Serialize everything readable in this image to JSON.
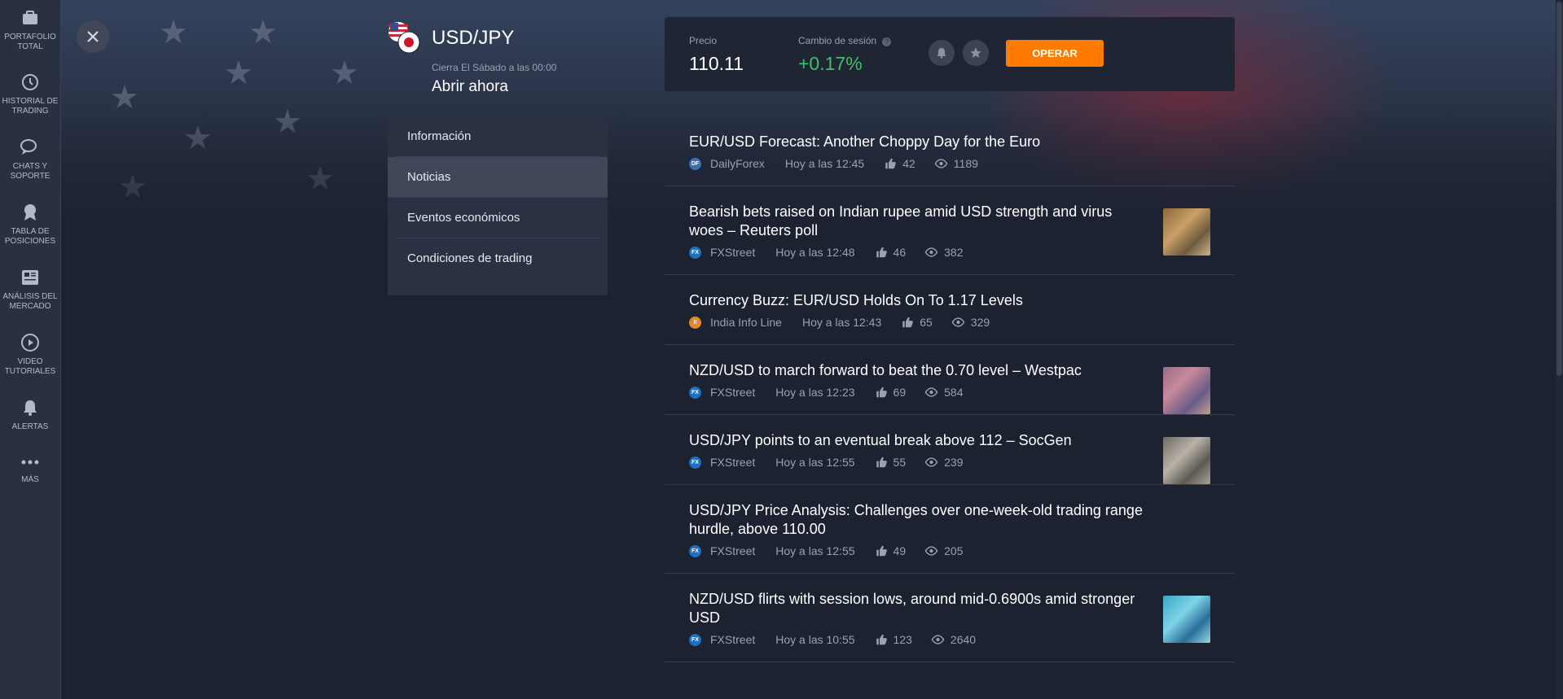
{
  "sidebar": {
    "items": [
      {
        "label_1": "PORTAFOLIO",
        "label_2": "TOTAL",
        "icon": "briefcase-icon"
      },
      {
        "label_1": "HISTORIAL DE",
        "label_2": "TRADING",
        "icon": "history-icon"
      },
      {
        "label_1": "CHATS Y",
        "label_2": "SOPORTE",
        "icon": "chat-icon"
      },
      {
        "label_1": "TABLA DE",
        "label_2": "POSICIONES",
        "icon": "award-icon"
      },
      {
        "label_1": "ANÁLISIS DEL",
        "label_2": "MERCADO",
        "icon": "newspaper-icon"
      },
      {
        "label_1": "VIDEO",
        "label_2": "TUTORIALES",
        "icon": "play-icon"
      },
      {
        "label_1": "ALERTAS",
        "label_2": "",
        "icon": "bell-icon"
      },
      {
        "label_1": "MÁS",
        "label_2": "",
        "icon": "more-dots-icon"
      }
    ]
  },
  "asset": {
    "title": "USD/JPY",
    "closes": "Cierra El Sábado a las 00:00",
    "open_now": "Abrir ahora"
  },
  "menu": {
    "items": [
      "Información",
      "Noticias",
      "Eventos económicos",
      "Condiciones de trading"
    ],
    "active": "Noticias"
  },
  "price_panel": {
    "price_label": "Precio",
    "price": "110.11",
    "change_label": "Cambio de sesión",
    "change": "+0.17%",
    "operate_button": "OPERAR",
    "change_color": "#3fc06a",
    "accent_color": "#ff7b00"
  },
  "news": [
    {
      "title": "EUR/USD Forecast: Another Choppy Day for the Euro",
      "source": "DailyForex",
      "time": "Hoy a las 12:45",
      "likes": "42",
      "views": "1189",
      "thumb": false,
      "icon_text": "DF",
      "icon_color": "#3a6fb0"
    },
    {
      "title": "Bearish bets raised on Indian rupee amid USD strength and virus woes – Reuters poll",
      "source": "FXStreet",
      "time": "Hoy a las 12:48",
      "likes": "46",
      "views": "382",
      "thumb": true,
      "icon_text": "FX",
      "icon_color": "#1f6fc0"
    },
    {
      "title": "Currency Buzz: EUR/USD Holds On To 1.17 Levels",
      "source": "India Info Line",
      "time": "Hoy a las 12:43",
      "likes": "65",
      "views": "329",
      "thumb": false,
      "icon_text": "II",
      "icon_color": "#e8872a"
    },
    {
      "title": "NZD/USD to march forward to beat the 0.70 level – Westpac",
      "source": "FXStreet",
      "time": "Hoy a las 12:23",
      "likes": "69",
      "views": "584",
      "thumb": true,
      "icon_text": "FX",
      "icon_color": "#1f6fc0"
    },
    {
      "title": "USD/JPY points to an eventual break above 112 – SocGen",
      "source": "FXStreet",
      "time": "Hoy a las 12:55",
      "likes": "55",
      "views": "239",
      "thumb": true,
      "icon_text": "FX",
      "icon_color": "#1f6fc0"
    },
    {
      "title": "USD/JPY Price Analysis: Challenges over one-week-old trading range hurdle, above 110.00",
      "source": "FXStreet",
      "time": "Hoy a las 12:55",
      "likes": "49",
      "views": "205",
      "thumb": false,
      "icon_text": "FX",
      "icon_color": "#1f6fc0"
    },
    {
      "title": "NZD/USD flirts with session lows, around mid-0.6900s amid stronger USD",
      "source": "FXStreet",
      "time": "Hoy a las 10:55",
      "likes": "123",
      "views": "2640",
      "thumb": true,
      "icon_text": "FX",
      "icon_color": "#1f6fc0"
    }
  ]
}
